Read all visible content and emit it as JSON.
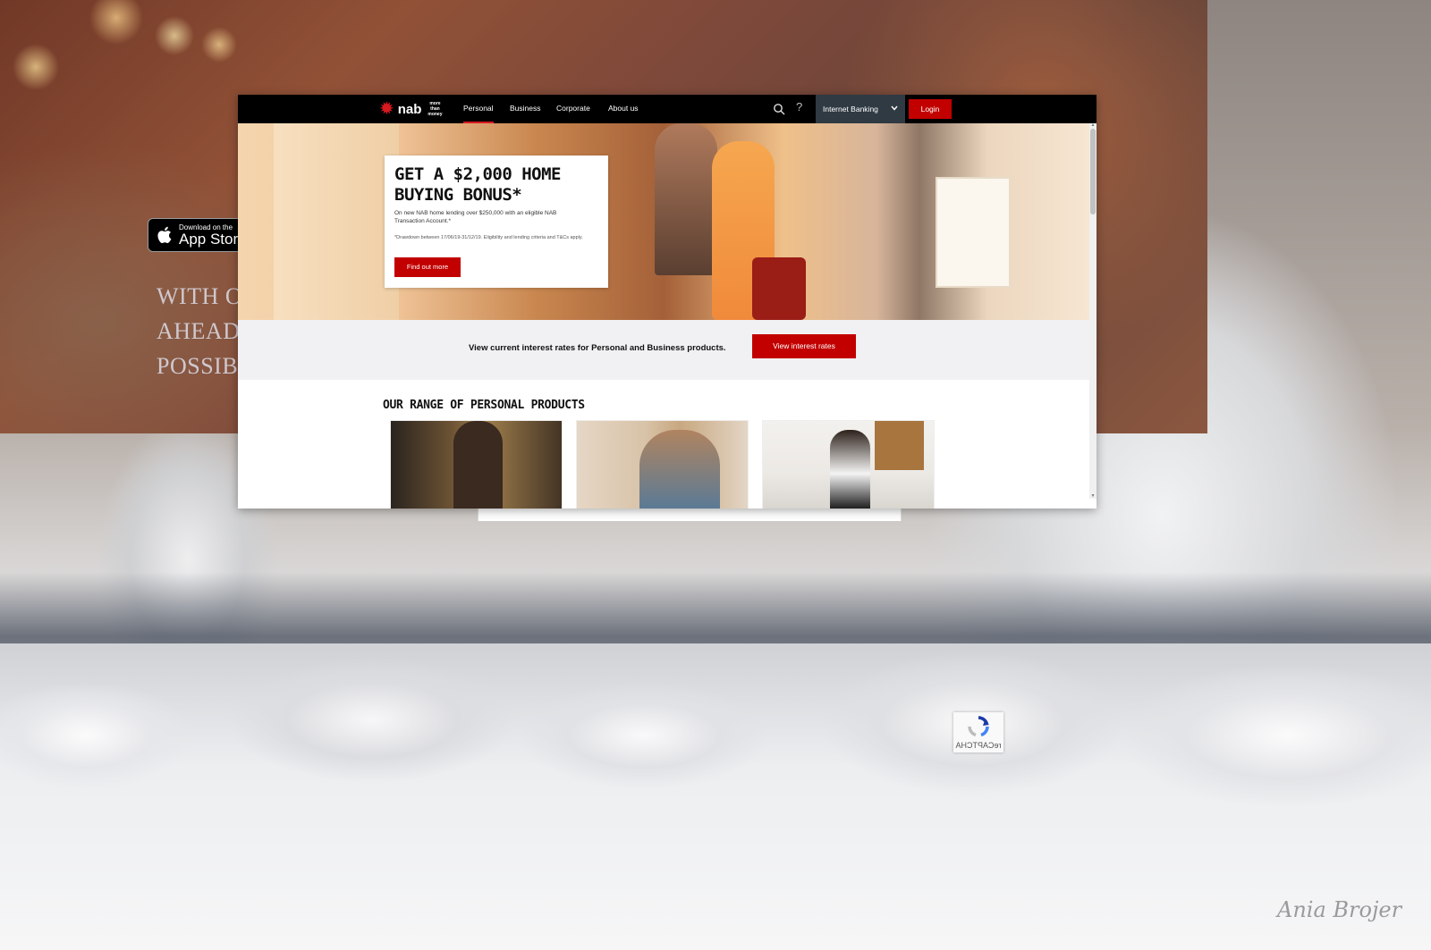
{
  "background": {
    "appstore": {
      "small": "Download on the",
      "big": "App Store"
    },
    "slogan": [
      "WITH O",
      "AHEAD",
      "POSSIBI"
    ],
    "watermark": "Ania Brojer"
  },
  "nav": {
    "brand": "nab",
    "tagline": "more than money",
    "items": [
      {
        "label": "Personal",
        "active": true
      },
      {
        "label": "Business"
      },
      {
        "label": "Corporate"
      },
      {
        "label": "About us"
      }
    ],
    "help": "?",
    "internet_banking": "Internet Banking",
    "login": "Login"
  },
  "hero": {
    "title": "GET A $2,000 HOME BUYING BONUS*",
    "body": "On new NAB home lending over $250,000 with an eligible NAB Transaction Account.*",
    "fine_print": "*Drawdown between 17/06/19-31/12/19. Eligibility and lending criteria and T&Cs apply.",
    "button": "Find out more"
  },
  "rates": {
    "text": "View current interest rates for Personal and Business products.",
    "button": "View interest rates"
  },
  "products": {
    "title": "OUR RANGE OF PERSONAL PRODUCTS"
  },
  "recaptcha": {
    "label": "reCAPTCHA"
  },
  "colors": {
    "brand_red": "#c20000",
    "nav_bg": "#000000",
    "ib_bg": "#2f3a43"
  }
}
